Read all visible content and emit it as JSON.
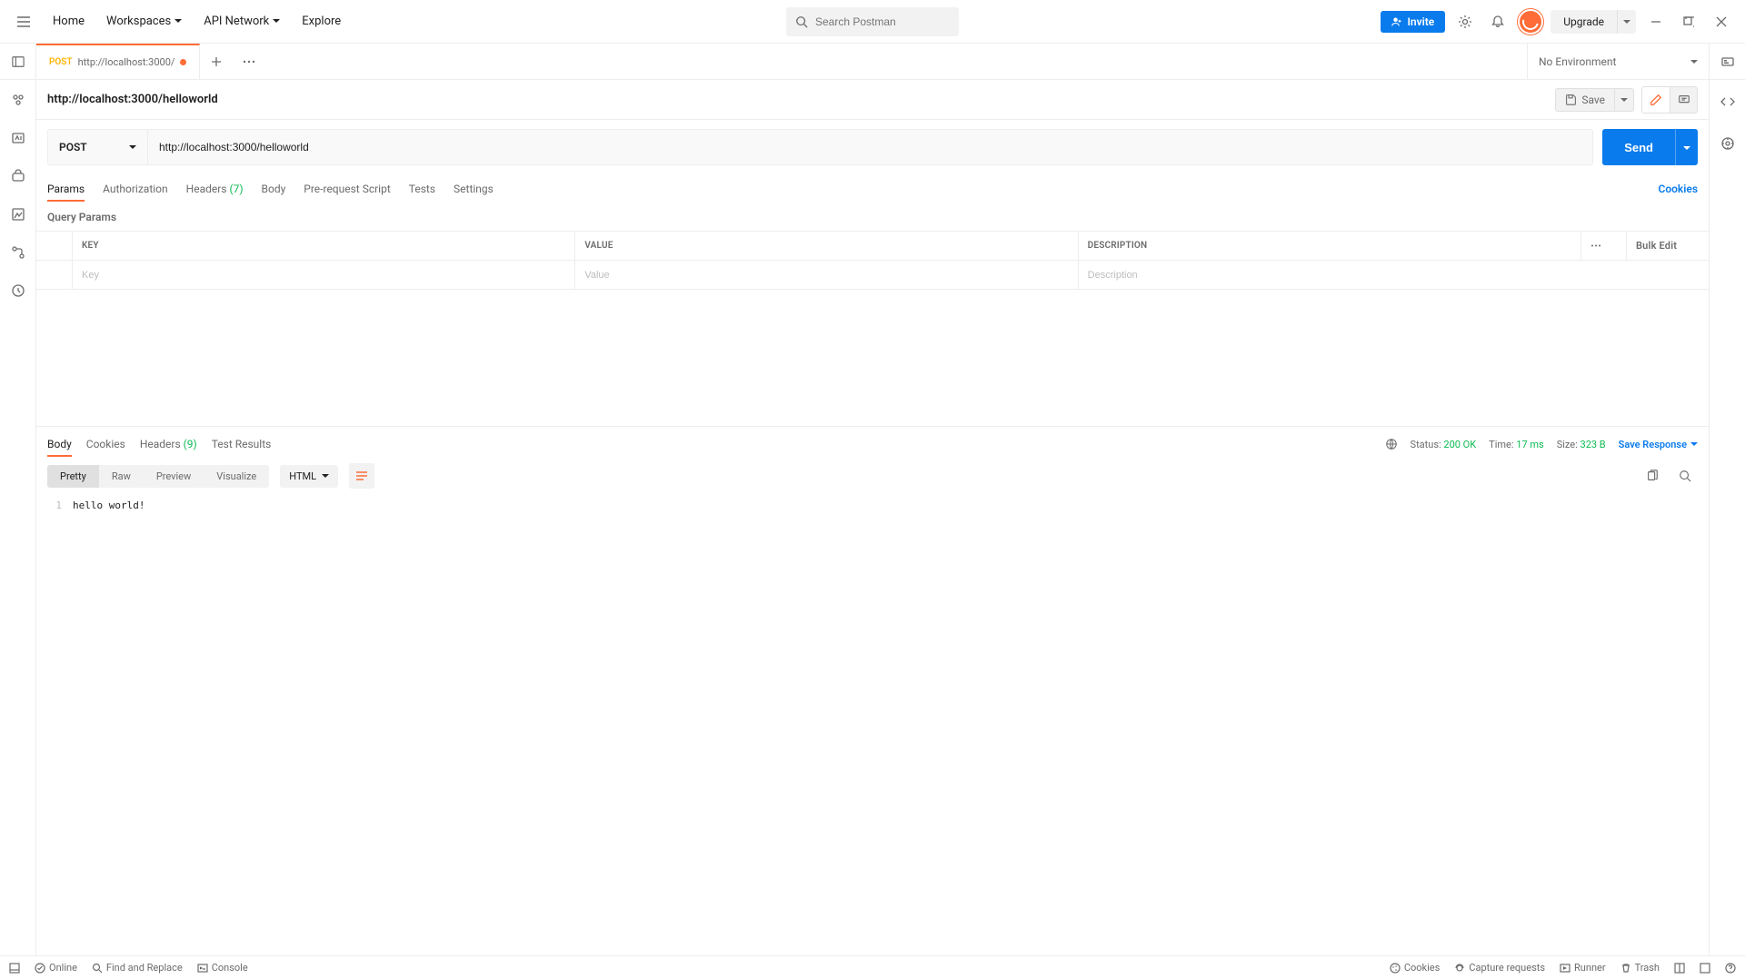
{
  "topbar": {
    "nav": [
      "Home",
      "Workspaces",
      "API Network",
      "Explore"
    ],
    "nav_caret": [
      false,
      true,
      true,
      false
    ],
    "search_placeholder": "Search Postman",
    "invite": "Invite",
    "upgrade": "Upgrade"
  },
  "tabs": {
    "item_method": "POST",
    "item_title": "http://localhost:3000/",
    "env_label": "No Environment"
  },
  "request": {
    "name": "http://localhost:3000/helloworld",
    "save_label": "Save",
    "method": "POST",
    "url": "http://localhost:3000/helloworld",
    "send": "Send",
    "tabs": {
      "params": "Params",
      "auth": "Authorization",
      "headers_label": "Headers",
      "headers_count": "(7)",
      "body": "Body",
      "prereq": "Pre-request Script",
      "tests": "Tests",
      "settings": "Settings"
    },
    "cookies_link": "Cookies",
    "qp_label": "Query Params",
    "table": {
      "key": "KEY",
      "value": "VALUE",
      "desc": "DESCRIPTION",
      "bulk": "Bulk Edit",
      "ph_key": "Key",
      "ph_value": "Value",
      "ph_desc": "Description"
    }
  },
  "response": {
    "tabs": {
      "body": "Body",
      "cookies": "Cookies",
      "headers_label": "Headers",
      "headers_count": "(9)",
      "tests": "Test Results"
    },
    "status_label": "Status:",
    "status_value": "200 OK",
    "time_label": "Time:",
    "time_value": "17 ms",
    "size_label": "Size:",
    "size_value": "323 B",
    "save_response": "Save Response",
    "views": {
      "pretty": "Pretty",
      "raw": "Raw",
      "preview": "Preview",
      "visualize": "Visualize"
    },
    "lang": "HTML",
    "body_content": "hello world!",
    "line_no": "1"
  },
  "footer": {
    "online": "Online",
    "find": "Find and Replace",
    "console": "Console",
    "cookies": "Cookies",
    "capture": "Capture requests",
    "runner": "Runner",
    "trash": "Trash"
  }
}
